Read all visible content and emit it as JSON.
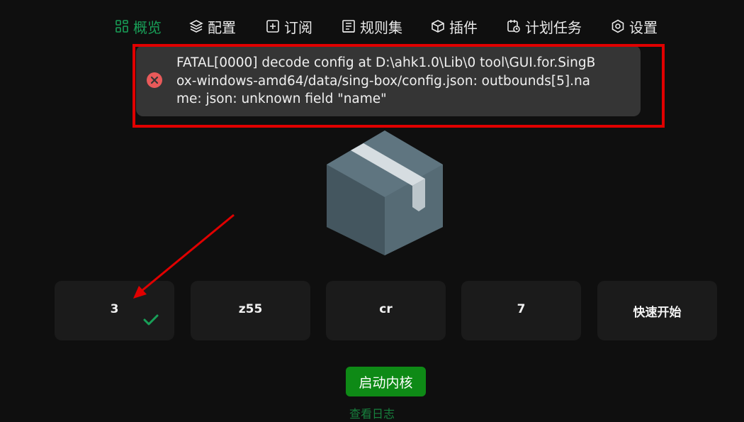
{
  "nav": {
    "items": [
      {
        "label": "概览",
        "icon": "dashboard-icon",
        "active": true
      },
      {
        "label": "配置",
        "icon": "layers-icon"
      },
      {
        "label": "订阅",
        "icon": "plus-square-icon"
      },
      {
        "label": "规则集",
        "icon": "ruleset-icon"
      },
      {
        "label": "插件",
        "icon": "cube-icon"
      },
      {
        "label": "计划任务",
        "icon": "calendar-clock-icon"
      },
      {
        "label": "设置",
        "icon": "settings-icon"
      }
    ]
  },
  "error_toast": {
    "icon": "error-circle-icon",
    "lines": [
      "FATAL[0000] decode config at D:\\ahk1.0\\Lib\\0 tool\\GUI.for.SingB",
      "ox-windows-amd64/data/sing-box/config.json: outbounds[5].na",
      "me: json: unknown field \"name\""
    ]
  },
  "profiles": [
    {
      "label": "3",
      "selected": true
    },
    {
      "label": "z55"
    },
    {
      "label": "cr"
    },
    {
      "label": "7"
    },
    {
      "label": "快速开始"
    }
  ],
  "actions": {
    "start_kernel": "启动内核",
    "view_logs": "查看日志"
  },
  "colors": {
    "accent": "#18a058",
    "button_green": "#0e8a16",
    "highlight_red": "#e00000",
    "background": "#0f0f0f"
  }
}
